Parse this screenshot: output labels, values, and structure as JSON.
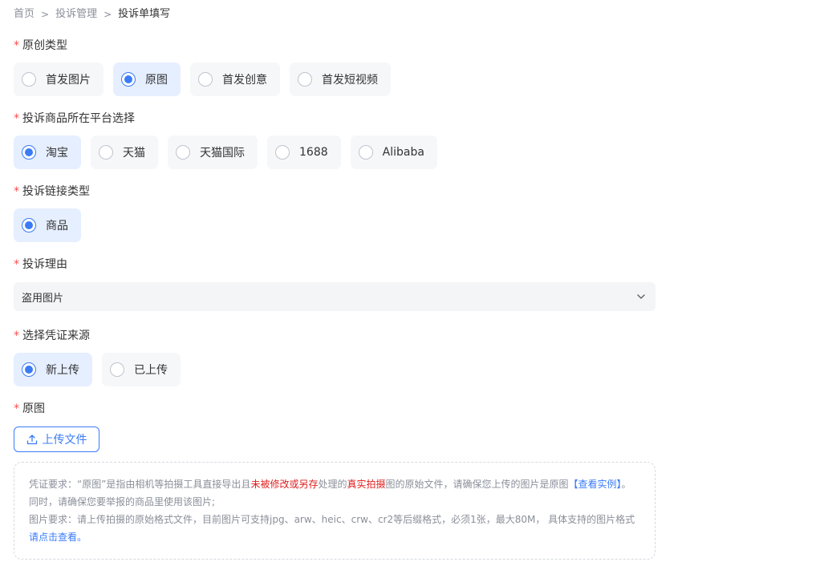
{
  "breadcrumb": {
    "items": [
      "首页",
      "投诉管理"
    ],
    "current": "投诉单填写",
    "separator": ">"
  },
  "sections": {
    "original_type": {
      "label": "原创类型",
      "options": [
        "首发图片",
        "原图",
        "首发创意",
        "首发短视频"
      ],
      "selected": "原图"
    },
    "platform": {
      "label": "投诉商品所在平台选择",
      "options": [
        "淘宝",
        "天猫",
        "天猫国际",
        "1688",
        "Alibaba"
      ],
      "selected": "淘宝"
    },
    "link_type": {
      "label": "投诉链接类型",
      "options": [
        "商品"
      ],
      "selected": "商品"
    },
    "reason": {
      "label": "投诉理由",
      "value": "盗用图片"
    },
    "evidence_source": {
      "label": "选择凭证来源",
      "options": [
        "新上传",
        "已上传"
      ],
      "selected": "新上传"
    },
    "original_image": {
      "label": "原图",
      "upload_label": "上传文件"
    }
  },
  "required_mark": "*",
  "notice": {
    "line1_a": "凭证要求：“原图”是指由相机等拍摄工具直接导出且",
    "line1_red1": "未被修改或另存",
    "line1_b": "处理的",
    "line1_red2": "真实拍摄",
    "line1_c": "图的原始文件，请确保您上传的图片是原图",
    "line1_link": "【查看实例】",
    "line1_end": "。",
    "line2": "同时，请确保您要举报的商品里使用该图片;",
    "line3_a": "图片要求：请上传拍摄的原始格式文件，目前图片可支持jpg、arw、heic、crw、cr2等后缀格式，必须1张，最大80M， 具体支持的图片格式",
    "line3_link": "请点击查看",
    "line3_end": "。"
  },
  "colors": {
    "accent": "#3b7cf6",
    "required": "#ff4d4f",
    "highlight": "#e02020"
  }
}
